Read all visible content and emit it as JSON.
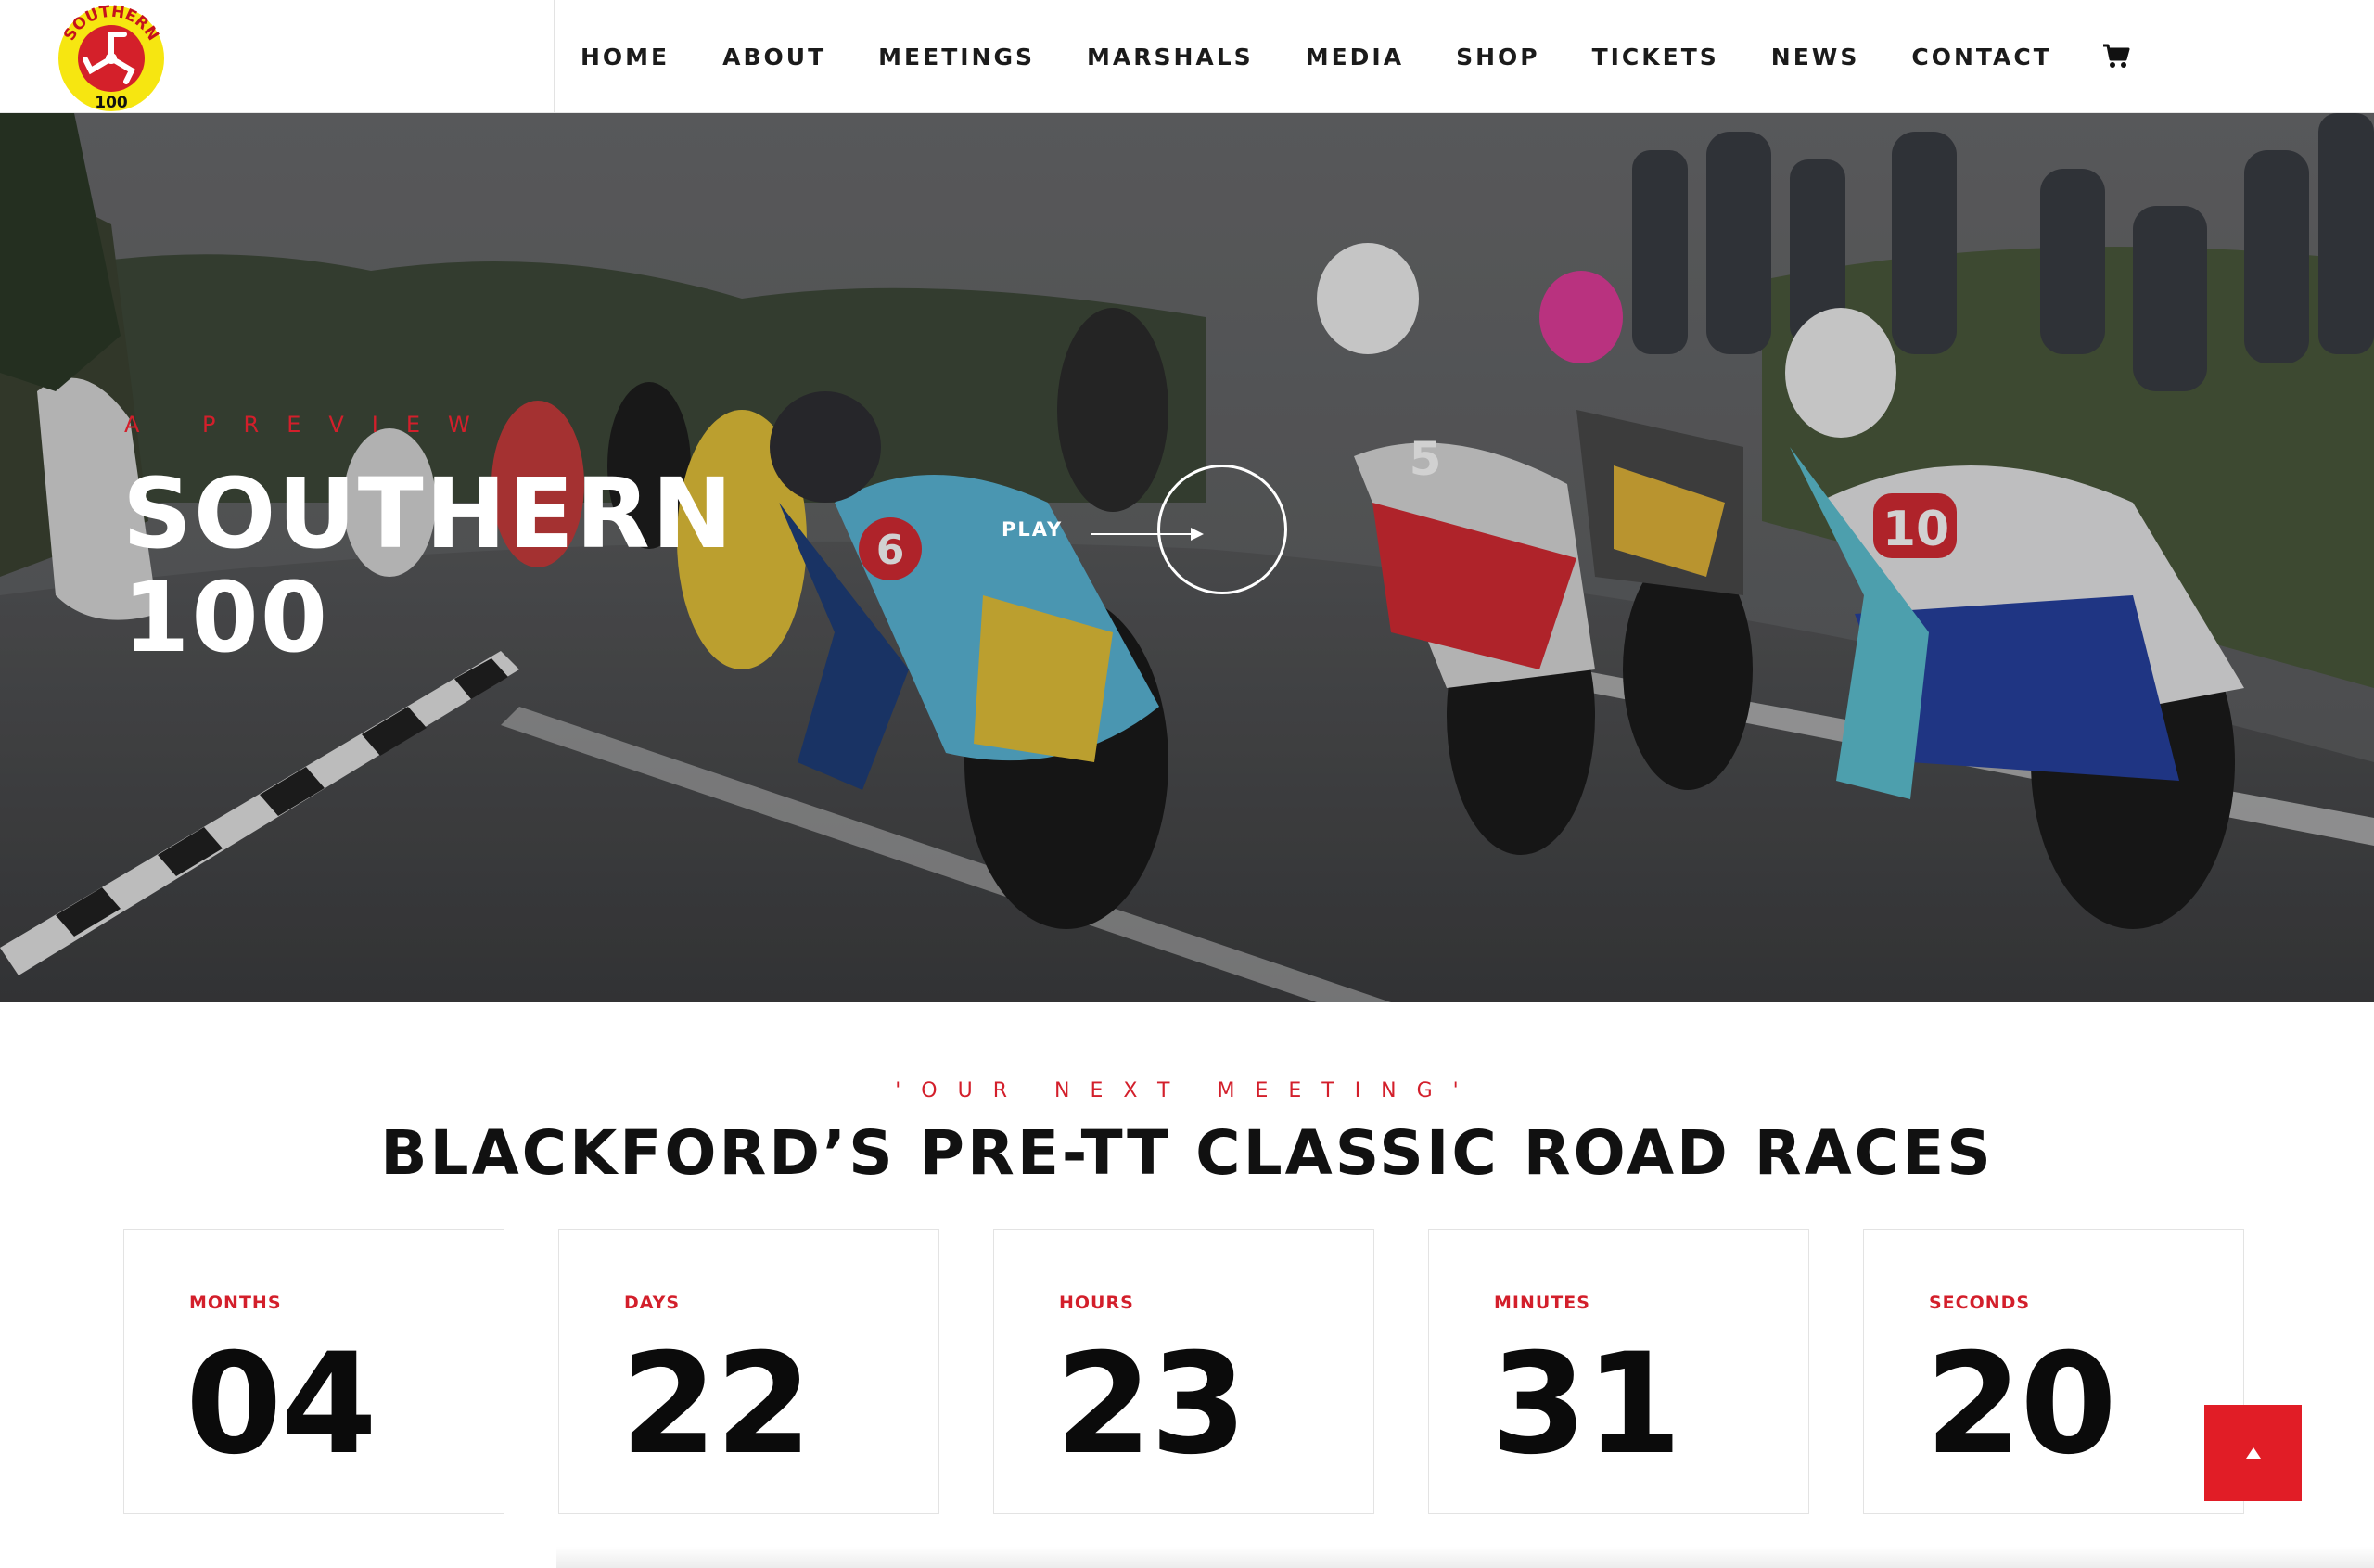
{
  "header": {
    "logo": {
      "text_top": "SOUTHERN",
      "text_bottom": "100",
      "ring_color": "#f6e611",
      "center_color": "#d4202a"
    },
    "nav": [
      {
        "label": "HOME",
        "active": true
      },
      {
        "label": "ABOUT"
      },
      {
        "label": "MEETINGS"
      },
      {
        "label": "MARSHALS"
      },
      {
        "label": "MEDIA"
      },
      {
        "label": "SHOP"
      },
      {
        "label": "TICKETS"
      },
      {
        "label": "NEWS"
      },
      {
        "label": "CONTACT"
      }
    ],
    "cart_icon": "shopping-cart-icon"
  },
  "hero": {
    "kicker": "A PREVIEW",
    "title": "SOUTHERN 100",
    "play_label": "PLAY"
  },
  "next_meeting": {
    "kicker": "'OUR NEXT MEETING'",
    "title": "BLACKFORD’S PRE-TT CLASSIC ROAD RACES"
  },
  "countdown": [
    {
      "label": "MONTHS",
      "value": "04"
    },
    {
      "label": "DAYS",
      "value": "22"
    },
    {
      "label": "HOURS",
      "value": "23"
    },
    {
      "label": "MINUTES",
      "value": "31"
    },
    {
      "label": "SECONDS",
      "value": "20"
    }
  ],
  "colors": {
    "accent": "#d31f2b",
    "button": "#e11d26",
    "text": "#111111"
  },
  "scroll_top_icon": "arrow-up-icon"
}
